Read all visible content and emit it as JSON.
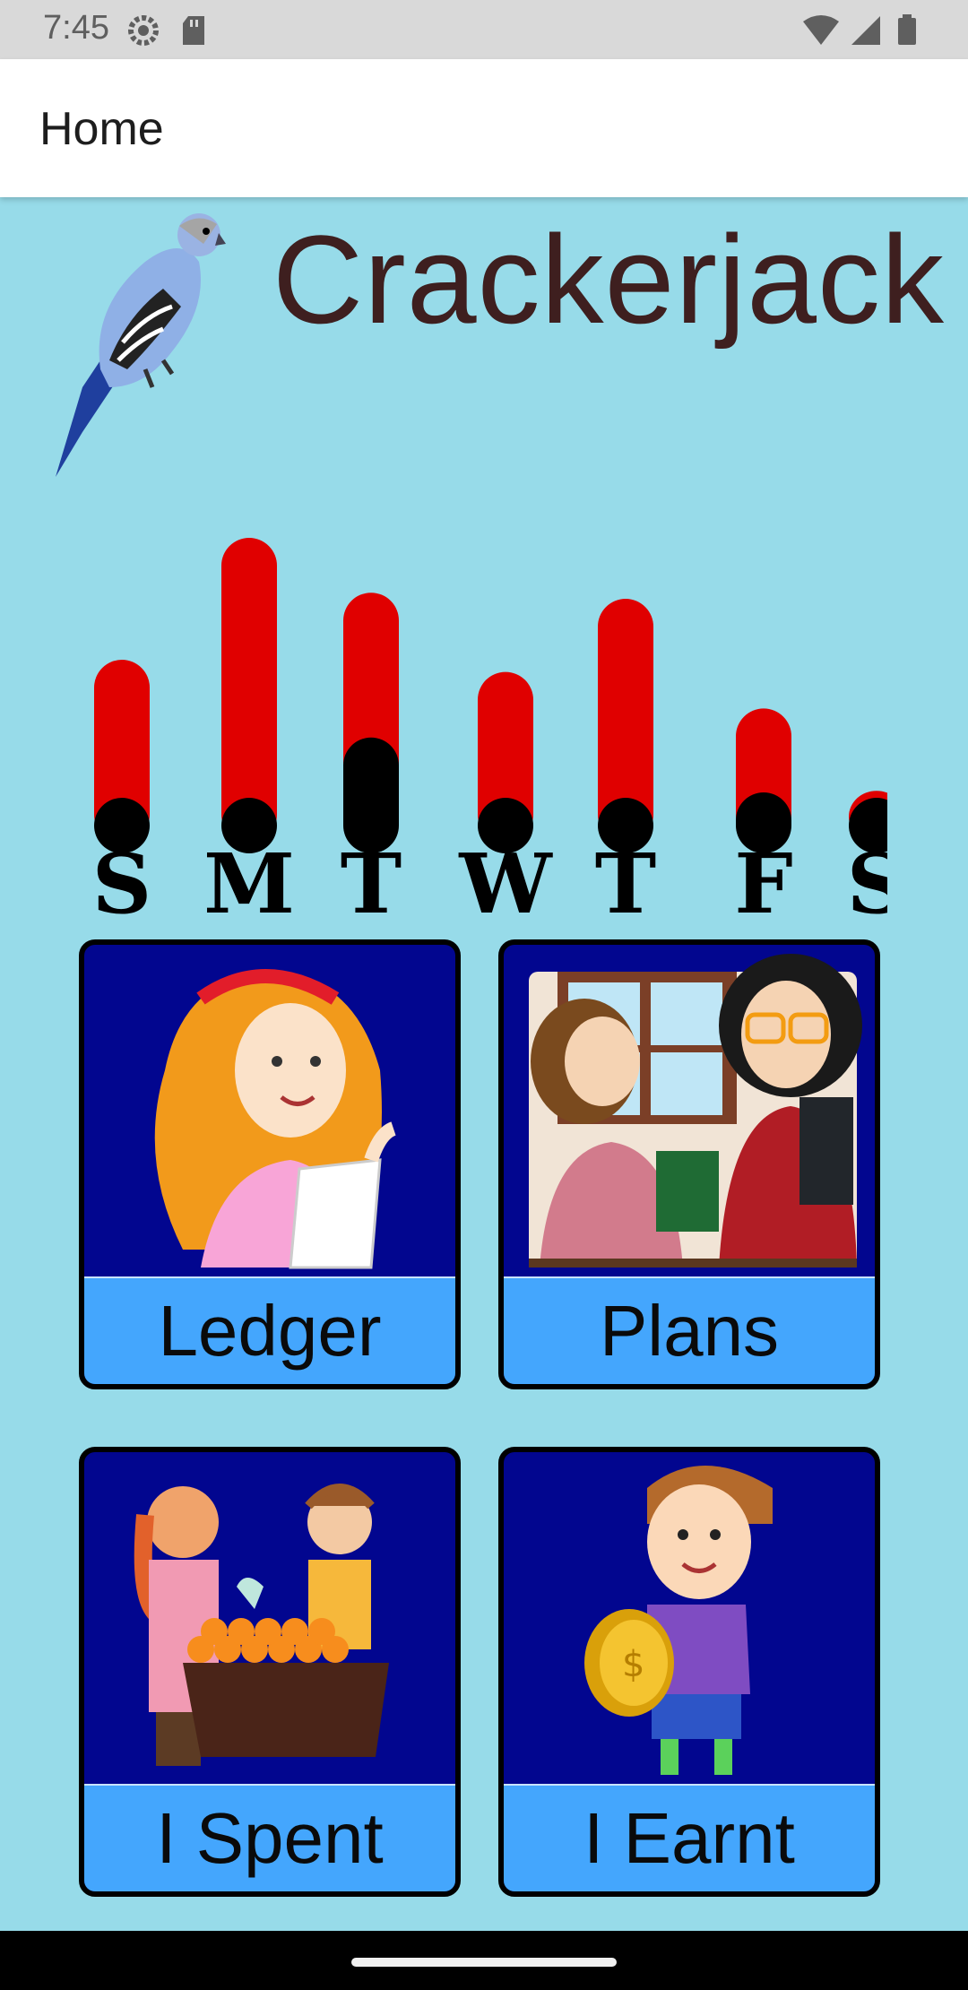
{
  "status_bar": {
    "time": "7:45",
    "icons_left": [
      "settings-icon",
      "sd-card-icon"
    ],
    "icons_right": [
      "wifi-icon",
      "signal-icon",
      "battery-icon"
    ]
  },
  "app_bar": {
    "title": "Home"
  },
  "header": {
    "app_name": "Crackerjack",
    "mascot": "budgie-icon"
  },
  "chart_data": {
    "type": "bar",
    "categories": [
      "S",
      "M",
      "T",
      "W",
      "T",
      "F",
      "S"
    ],
    "series": [
      {
        "color": "#e00000",
        "values": [
          0.6,
          1.0,
          0.82,
          0.56,
          0.8,
          0.44,
          0.17
        ]
      },
      {
        "color": "#000000",
        "values": [
          0.05,
          0.12,
          0.38,
          0.17,
          0.08,
          0.2,
          0.07
        ]
      }
    ],
    "ylim": [
      0,
      1
    ],
    "grid": false,
    "legend": "none"
  },
  "tiles": [
    {
      "label": "Ledger",
      "image": "girl-reading-list-image"
    },
    {
      "label": "Plans",
      "image": "girl-and-teacher-image"
    },
    {
      "label": "I Spent",
      "image": "kids-buying-oranges-image"
    },
    {
      "label": "I Earnt",
      "image": "boy-holding-coin-image"
    }
  ],
  "colors": {
    "background": "#97dbe9",
    "tile": "#02068f",
    "tile_label": "#44a6fd",
    "accent_red": "#e00000",
    "title_text": "#3e1f1f"
  }
}
